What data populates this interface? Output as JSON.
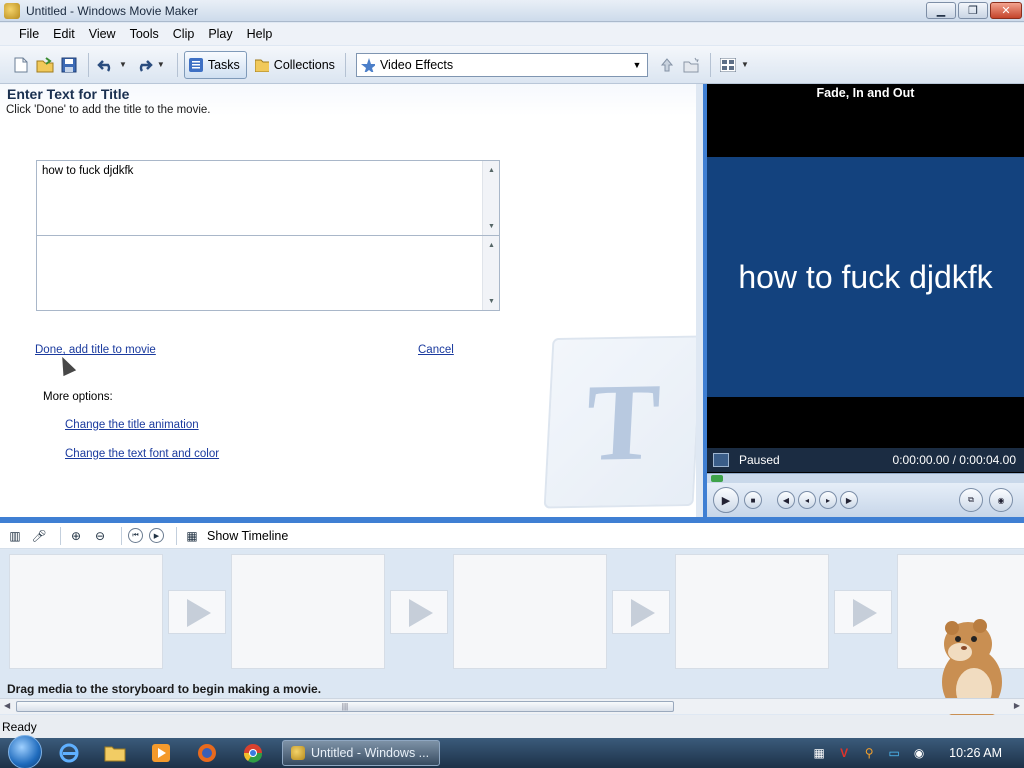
{
  "window": {
    "title": "Untitled - Windows Movie Maker",
    "minimize": "▁",
    "maximize": "❐",
    "close": "✕"
  },
  "menu": [
    "File",
    "Edit",
    "View",
    "Tools",
    "Clip",
    "Play",
    "Help"
  ],
  "toolbar": {
    "tasks_label": "Tasks",
    "collections_label": "Collections",
    "effects_value": "Video Effects"
  },
  "task_pane": {
    "title": "Enter Text for Title",
    "subtitle": "Click 'Done' to add the title to the movie.",
    "title_text_value": "how to fuck djdkfk",
    "subtext_value": "",
    "done_link": "Done, add title to movie",
    "cancel_link": "Cancel",
    "more_options_label": "More options:",
    "animation_link": "Change the title animation",
    "font_link": "Change the text font and color"
  },
  "preview": {
    "effect_title": "Fade, In and Out",
    "display_text": "how to fuck djdkfk",
    "status": "Paused",
    "time": "0:00:00.00 / 0:00:04.00",
    "progress": 0.0
  },
  "storyboard": {
    "show_timeline_label": "Show Timeline",
    "hint": "Drag media to the storyboard to begin making a movie.",
    "frame_count": 5
  },
  "status_bar": {
    "text": "Ready"
  },
  "taskbar": {
    "window_button": "Untitled - Windows ...",
    "clock": "10:26 AM"
  },
  "colors": {
    "accent_blue": "#3f7fd3",
    "preview_bg": "#13427e",
    "link": "#1a3a9e"
  }
}
